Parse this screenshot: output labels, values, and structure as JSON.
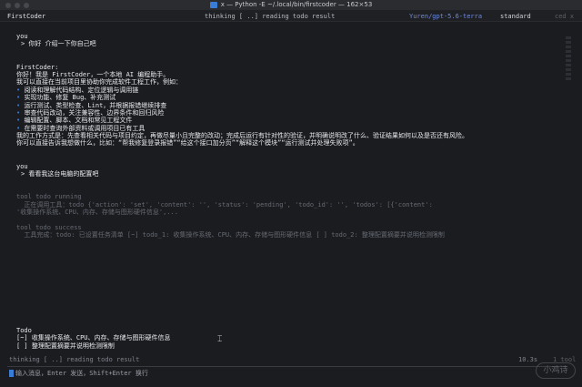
{
  "window": {
    "title": "x — Python -E ~/.local/bin/firstcoder — 162×53"
  },
  "status": {
    "app": "FirstCoder",
    "activity": "thinking [ ..] reading todo result",
    "model": "Yuren/gpt-5.6-terra",
    "mode": "standard",
    "cwd": "ced x"
  },
  "transcript": {
    "user1": {
      "label": "you",
      "text": "> 你好 介绍一下你自己吧"
    },
    "assistant": {
      "label": "FirstCoder:",
      "intro1": "你好！我是 FirstCoder，一个本地 AI 编程助手。",
      "intro2": "我可以直接在当前项目里协助你完成软件工程工作，例如：",
      "bullets": [
        "阅读和理解代码结构、定位逻辑与调用链",
        "实现功能、修复 Bug、补充测试",
        "运行测试、类型检查、Lint，并根据报错继续排查",
        "审查代码改动，关注兼容性、边界条件和回归风险",
        "编辑配置、脚本、文档和常见工程文件",
        "在需要时查询外部资料或调用项目已有工具"
      ],
      "bullet_symbol": "•",
      "outro1": "我的工作方式是：先查看相关代码与项目约定，再做尽量小且完整的改动；完成后运行有针对性的验证，并明确说明改了什么、验证结果如何以及是否还有风险。",
      "outro2": "你可以直接告诉我想做什么，比如：“帮我修复登录报错”“给这个接口加分页”“解释这个模块”“运行测试并处理失败项”。"
    },
    "user2": {
      "label": "you",
      "text": "> 看看我这台电脑的配置吧"
    },
    "tool1": {
      "title": "tool todo running",
      "line1": "  正在调用工具：todo {'action': 'set', 'content': '', 'status': 'pending', 'todo_id': '', 'todos': [{'content':",
      "line2": "'收集操作系统、CPU、内存、存储与图形硬件信息',..."
    },
    "tool2": {
      "title": "tool todo success",
      "line1": "  工具完成：todo: 已设置任务清单 [~] todo_1: 收集操作系统、CPU、内存、存储与图形硬件信息 [ ] todo_2: 整理配置摘要并说明检测限制"
    }
  },
  "todo": {
    "title": "Todo",
    "items": [
      "[~] 收集操作系统、CPU、内存、存储与图形硬件信息",
      "[ ] 整理配置摘要并说明检测限制"
    ]
  },
  "footer": {
    "activity": "thinking [ ..] reading todo result",
    "elapsed": "10.3s",
    "tool_count": "1 tool",
    "input_hint": "输入消息，Enter 发送，Shift+Enter 换行",
    "watermark": "小鸡诗"
  },
  "colors": {
    "accent": "#3a7bd5",
    "model": "#6f8bdb",
    "background": "#1b1c20"
  }
}
